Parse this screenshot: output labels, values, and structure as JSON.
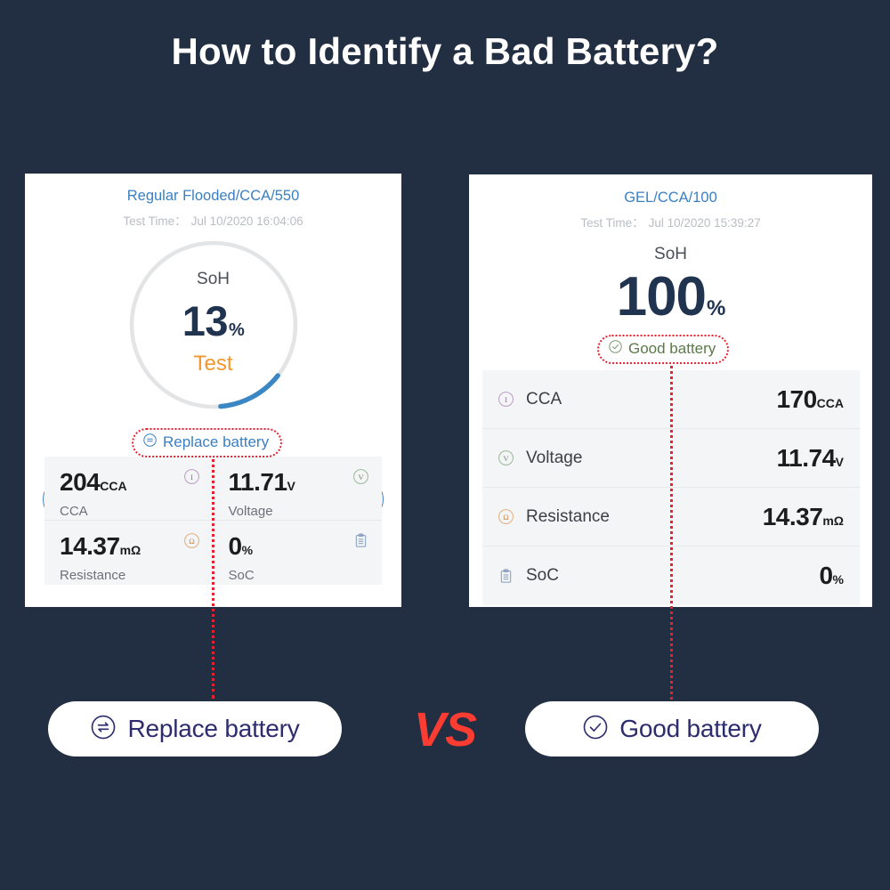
{
  "page": {
    "title": "How to Identify a Bad Battery?",
    "background_color": "#222e41",
    "vs_label": "VS",
    "accent_red": "#e8212f",
    "accent_blue": "#3a7fc1",
    "accent_green": "#5a7a4a",
    "accent_orange": "#f2972e"
  },
  "bad_card": {
    "title": "Regular Flooded/CCA/550",
    "test_time_label": "Test Time：",
    "test_time_value": "Jul 10/2020 16:04:06",
    "gauge": {
      "label": "SoH",
      "value": "13",
      "unit": "%",
      "percent": 13,
      "action_label": "Test",
      "track_color": "#e3e4e6",
      "arc_color": "#3a87c4"
    },
    "left_icon": "link-icon",
    "right_icon": "share-icon",
    "status": {
      "icon": "replace-battery-icon",
      "text": "Replace battery"
    },
    "metrics": [
      {
        "icon": "current-icon",
        "value": "204",
        "unit": "CCA",
        "name": "CCA"
      },
      {
        "icon": "voltage-icon",
        "value": "11.71",
        "unit": "V",
        "name": "Voltage"
      },
      {
        "icon": "resistance-icon",
        "value": "14.37",
        "unit": "mΩ",
        "name": "Resistance"
      },
      {
        "icon": "soc-icon",
        "value": "0",
        "unit": "%",
        "name": "SoC"
      }
    ]
  },
  "good_card": {
    "title": "GEL/CCA/100",
    "test_time_label": "Test Time：",
    "test_time_value": "Jul 10/2020 15:39:27",
    "soh": {
      "label": "SoH",
      "value": "100",
      "unit": "%"
    },
    "status": {
      "icon": "good-battery-icon",
      "text": "Good battery"
    },
    "metrics": [
      {
        "icon": "current-icon",
        "name": "CCA",
        "value": "170",
        "unit": "CCA"
      },
      {
        "icon": "voltage-icon",
        "name": "Voltage",
        "value": "11.74",
        "unit": "V"
      },
      {
        "icon": "resistance-icon",
        "name": "Resistance",
        "value": "14.37",
        "unit": "mΩ"
      },
      {
        "icon": "soc-icon",
        "name": "SoC",
        "value": "0",
        "unit": "%"
      }
    ]
  },
  "conclusion": {
    "bad": {
      "icon": "replace-battery-icon",
      "text": "Replace battery"
    },
    "good": {
      "icon": "good-battery-icon",
      "text": "Good battery"
    }
  }
}
